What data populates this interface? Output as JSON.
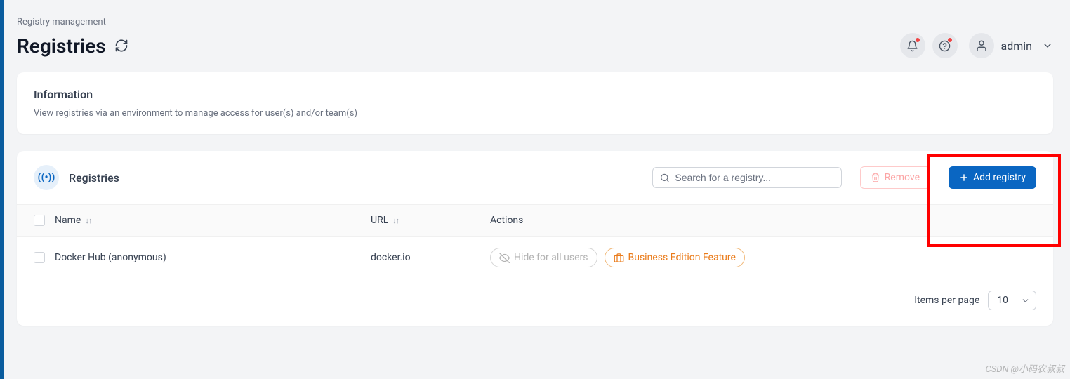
{
  "breadcrumb": "Registry management",
  "page_title": "Registries",
  "user": {
    "name": "admin"
  },
  "info_card": {
    "heading": "Information",
    "text": "View registries via an environment to manage access for user(s) and/or team(s)"
  },
  "registries_panel": {
    "title": "Registries",
    "search_placeholder": "Search for a registry...",
    "remove_label": "Remove",
    "add_label": "Add registry",
    "columns": {
      "name": "Name",
      "url": "URL",
      "actions": "Actions"
    },
    "rows": [
      {
        "name": "Docker Hub (anonymous)",
        "url": "docker.io",
        "hide_label": "Hide for all users",
        "feature_label": "Business Edition Feature"
      }
    ],
    "footer": {
      "label": "Items per page",
      "value": "10"
    }
  },
  "watermark": "CSDN @小码农叔叔"
}
